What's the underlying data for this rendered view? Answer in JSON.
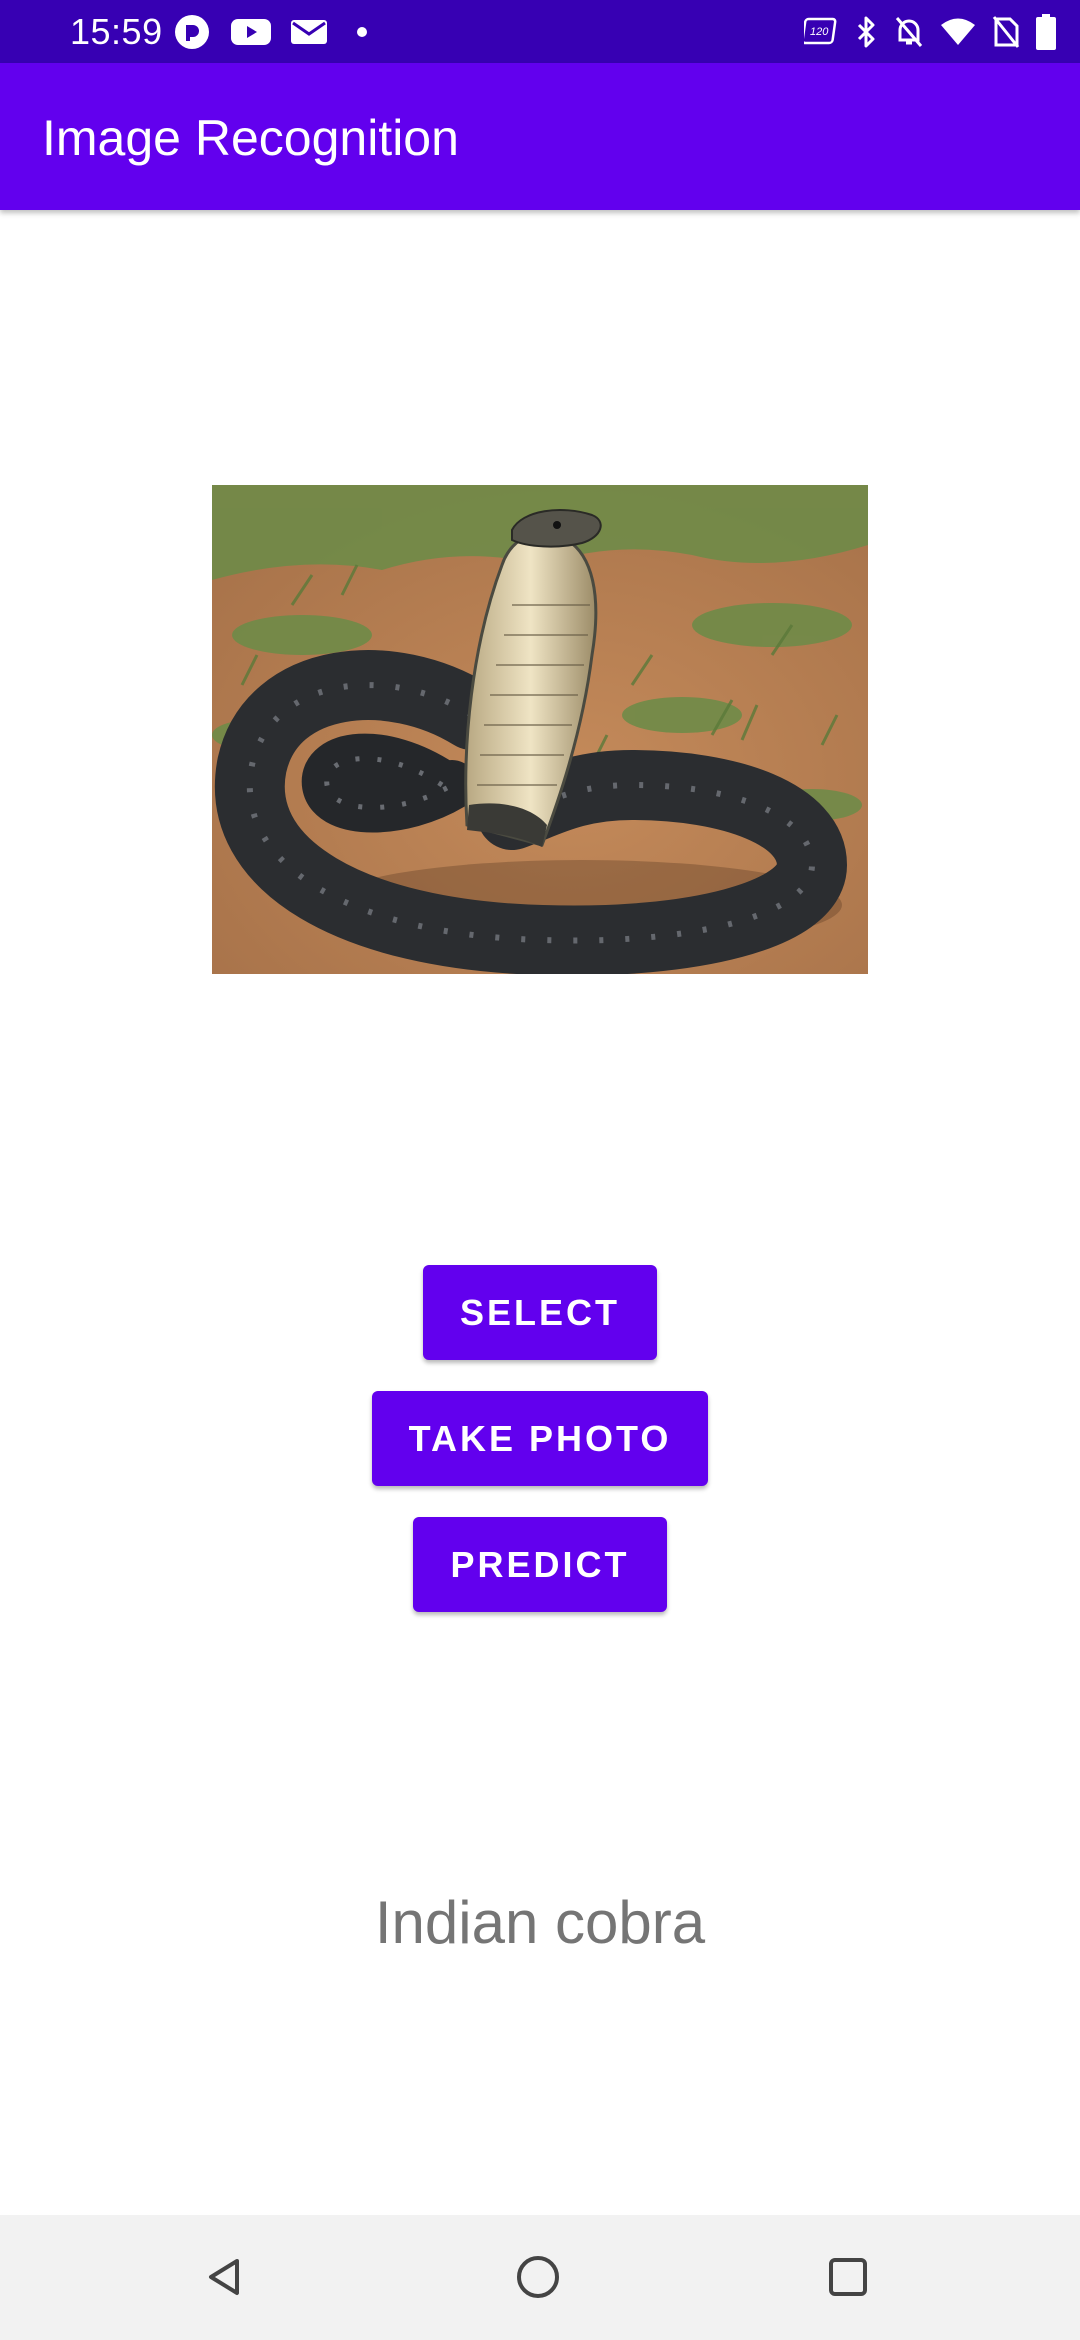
{
  "status_bar": {
    "time": "15:59",
    "left_icons": [
      "pocketcasts-icon",
      "youtube-icon",
      "mail-icon",
      "notification-dot-icon"
    ],
    "right_icons": [
      "refresh-rate-120hz-icon",
      "bluetooth-icon",
      "mute-bell-icon",
      "wifi-icon",
      "no-sim-icon",
      "battery-icon"
    ]
  },
  "app_bar": {
    "title": "Image Recognition"
  },
  "image": {
    "subject": "king cobra photo"
  },
  "buttons": {
    "select": "Select",
    "take_photo": "Take Photo",
    "predict": "Predict"
  },
  "result": {
    "label": "Indian cobra"
  },
  "navigation": {
    "icons": [
      "back-icon",
      "home-icon",
      "recents-icon"
    ]
  },
  "colors": {
    "status_bar": "#3700b3",
    "primary": "#6200ee",
    "result_text": "#757575"
  }
}
